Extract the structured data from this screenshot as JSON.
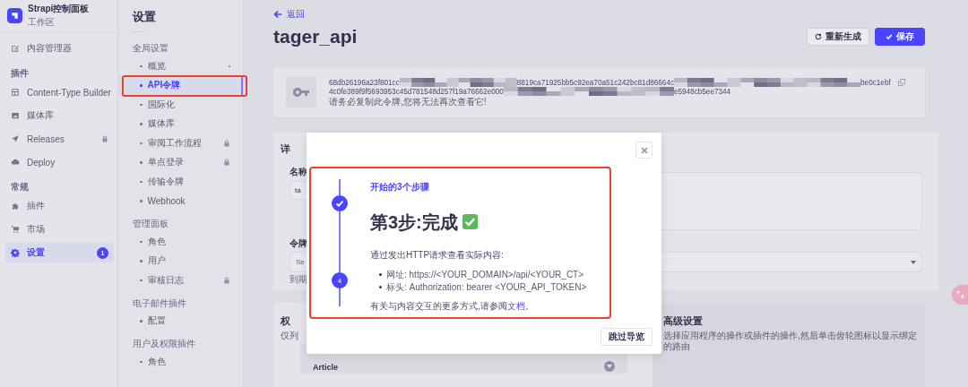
{
  "sidebar": {
    "brand": {
      "title": "Strapi控制面板",
      "subtitle": "工作区"
    },
    "sections": [
      {
        "items": [
          {
            "label": "内容管理器",
            "kind": "content",
            "selected": false,
            "locked": false
          }
        ]
      },
      {
        "title": "插件",
        "items": [
          {
            "label": "Content-Type Builder",
            "kind": "builder",
            "selected": false,
            "locked": false
          },
          {
            "label": "媒体库",
            "kind": "media",
            "selected": false,
            "locked": false
          },
          {
            "label": "Releases",
            "kind": "releases",
            "selected": false,
            "locked": true
          },
          {
            "label": "Deploy",
            "kind": "deploy",
            "selected": false,
            "locked": false
          }
        ]
      },
      {
        "title": "常规",
        "items": [
          {
            "label": "插件",
            "kind": "plugins",
            "selected": false,
            "locked": false
          },
          {
            "label": "市场",
            "kind": "market",
            "selected": false,
            "locked": false
          },
          {
            "label": "设置",
            "kind": "settings",
            "selected": true,
            "locked": false,
            "badge": "1"
          }
        ]
      }
    ]
  },
  "settings_nav": {
    "title": "设置",
    "groups": [
      {
        "title": "全局设置",
        "items": [
          {
            "label": "概览",
            "selected": false,
            "locked": false,
            "dot": true
          },
          {
            "label": "API令牌",
            "selected": true,
            "locked": false,
            "dot": false
          },
          {
            "label": "国际化",
            "selected": false,
            "locked": false,
            "dot": false
          },
          {
            "label": "媒体库",
            "selected": false,
            "locked": false,
            "dot": false
          },
          {
            "label": "审阅工作流程",
            "selected": false,
            "locked": true,
            "dot": false
          },
          {
            "label": "单点登录",
            "selected": false,
            "locked": true,
            "dot": false
          },
          {
            "label": "传输令牌",
            "selected": false,
            "locked": false,
            "dot": false
          },
          {
            "label": "Webhook",
            "selected": false,
            "locked": false,
            "dot": false
          }
        ]
      },
      {
        "title": "管理面板",
        "items": [
          {
            "label": "角色",
            "selected": false,
            "locked": false,
            "dot": false
          },
          {
            "label": "用户",
            "selected": false,
            "locked": false,
            "dot": false
          },
          {
            "label": "审核日志",
            "selected": false,
            "locked": true,
            "dot": false
          }
        ]
      },
      {
        "title": "电子邮件插件",
        "items": [
          {
            "label": "配置",
            "selected": false,
            "locked": false,
            "dot": false
          }
        ]
      },
      {
        "title": "用户及权限插件",
        "items": [
          {
            "label": "角色",
            "selected": false,
            "locked": false,
            "dot": false
          }
        ]
      }
    ]
  },
  "page": {
    "back_link": "返回",
    "title": "tager_api",
    "buttons": [
      {
        "label": "重新生成",
        "kind": "secondary"
      },
      {
        "label": "保存",
        "kind": "primary"
      }
    ]
  },
  "token_card": {
    "line_1": [
      "68db26196a23f801cc",
      "8819ca71925bb5c92ea70a51c242bc81d86664c",
      "be0c1ebf"
    ],
    "line_2": [
      "4c0fe389f9f5693953c45d781548d257f19a76662e000",
      "e5948cb5ee7344"
    ],
    "note": "请务必复制此令牌,您将无法再次查看它!"
  },
  "details": {
    "heading": "详",
    "name_label": "名称",
    "name_value": "ta",
    "token_label": "令牌",
    "select_placeholder": "Se",
    "expiry_hint": "到期"
  },
  "permissions": {
    "heading": "权",
    "description": "仅列",
    "group": "Article"
  },
  "advanced": {
    "heading": "高级设置",
    "description": "选择应用程序的操作或插件的操作,然后单击齿轮图标以显示绑定的路由"
  },
  "modal": {
    "eyebrow": "开始的3个步骤",
    "heading": "第3步:完成",
    "description": "通过发出HTTP请求查看实际内容:",
    "bullets": [
      "网址: https://<YOUR_DOMAIN>/api/<YOUR_CT>",
      "标头: Authorization: bearer <YOUR_API_TOKEN>"
    ],
    "note": "有关与内容交互的更多方式,请参阅",
    "note_link": "文档",
    "note_end": "。",
    "steps": [
      {
        "kind": "done"
      },
      {
        "kind": "number",
        "label": "4"
      }
    ],
    "skip_button": "跳过导览"
  }
}
